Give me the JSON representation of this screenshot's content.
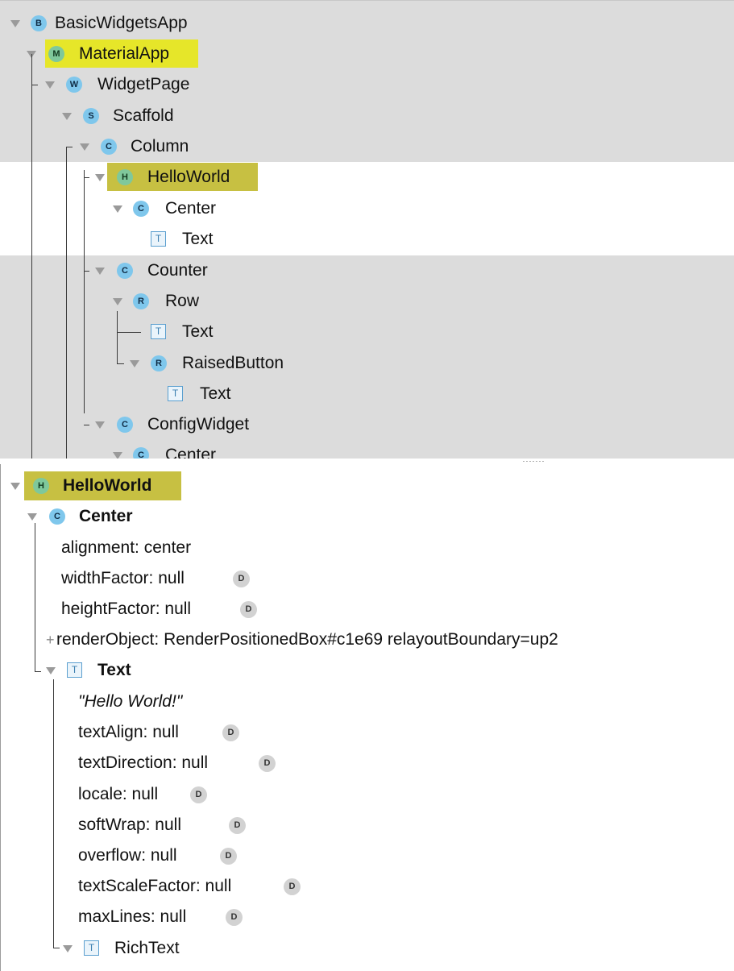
{
  "widget_tree": {
    "nodes": [
      {
        "badge": "B",
        "label": "BasicWidgetsApp"
      },
      {
        "badge": "M",
        "label": "MaterialApp"
      },
      {
        "badge": "W",
        "label": "WidgetPage"
      },
      {
        "badge": "S",
        "label": "Scaffold"
      },
      {
        "badge": "C",
        "label": "Column"
      },
      {
        "badge": "H",
        "label": "HelloWorld"
      },
      {
        "badge": "C",
        "label": "Center"
      },
      {
        "badge": "T",
        "label": "Text"
      },
      {
        "badge": "C",
        "label": "Counter"
      },
      {
        "badge": "R",
        "label": "Row"
      },
      {
        "badge": "T",
        "label": "Text"
      },
      {
        "badge": "R",
        "label": "RaisedButton"
      },
      {
        "badge": "T",
        "label": "Text"
      },
      {
        "badge": "C",
        "label": "ConfigWidget"
      },
      {
        "badge": "C",
        "label": "Center"
      }
    ]
  },
  "properties": {
    "root": {
      "badge": "H",
      "label": "HelloWorld"
    },
    "center": {
      "badge": "C",
      "label": "Center"
    },
    "center_props": [
      {
        "text": "alignment: center",
        "default_badge": ""
      },
      {
        "text": "widthFactor: null",
        "default_badge": "D"
      },
      {
        "text": "heightFactor: null",
        "default_badge": "D"
      }
    ],
    "render_object": {
      "prefix": "+",
      "text": "renderObject: RenderPositionedBox#c1e69 relayoutBoundary=up2"
    },
    "text_node": {
      "badge": "T",
      "label": "Text"
    },
    "text_value": "\"Hello World!\"",
    "text_props": [
      {
        "text": "textAlign: null",
        "default_badge": "D"
      },
      {
        "text": "textDirection: null",
        "default_badge": "D"
      },
      {
        "text": "locale: null",
        "default_badge": "D"
      },
      {
        "text": "softWrap: null",
        "default_badge": "D"
      },
      {
        "text": "overflow: null",
        "default_badge": "D"
      },
      {
        "text": "textScaleFactor: null",
        "default_badge": "D"
      },
      {
        "text": "maxLines: null",
        "default_badge": "D"
      }
    ],
    "rich_text": {
      "badge": "T",
      "label": "RichText"
    }
  },
  "colors": {
    "tree_background": "#dcdcdc",
    "selection_background": "#ffffff",
    "highlight_yellow": "#e6e629",
    "highlight_olive": "#c7c042",
    "badge_blue": "#7fc7ec",
    "badge_green": "#7fc89b",
    "default_badge_gray": "#d2d2d2"
  }
}
